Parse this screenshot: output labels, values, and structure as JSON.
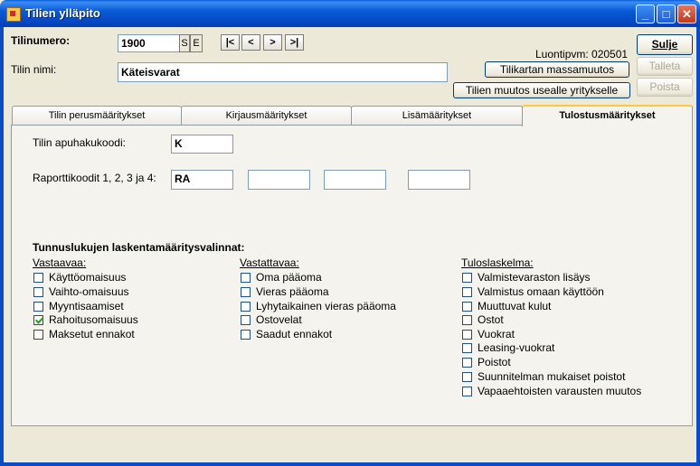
{
  "window": {
    "title": "Tilien ylläpito",
    "controls": {
      "minimize": "_",
      "maximize": "□",
      "close": "✕"
    }
  },
  "header": {
    "account_number_label": "Tilinumero:",
    "account_number_value": "1900",
    "flag_s": "S",
    "flag_e": "E",
    "nav": [
      "|<",
      "<",
      ">",
      ">|"
    ],
    "account_name_label": "Tilin nimi:",
    "account_name_value": "Käteisvarat",
    "created_text": "Luontipvm: 020501",
    "mass_change_button": "Tilikartan massamuutos",
    "multi_company_button": "Tilien muutos usealle yritykselle"
  },
  "actions": {
    "close": "Sulje",
    "save": "Talleta",
    "delete": "Poista"
  },
  "tabs": [
    {
      "label": "Tilin perusmääritykset",
      "active": false
    },
    {
      "label": "Kirjausmääritykset",
      "active": false
    },
    {
      "label": "Lisämääritykset",
      "active": false
    },
    {
      "label": "Tulostusmääritykset",
      "active": true
    }
  ],
  "print_settings": {
    "helper_code_label": "Tilin apuhakukoodi:",
    "helper_code_value": "K",
    "report_codes_label": "Raporttikoodit 1, 2, 3 ja 4:",
    "report_codes": [
      "RA",
      "",
      "",
      ""
    ],
    "kpi_heading": "Tunnuslukujen laskentamääritysvalinnat:",
    "groups": [
      {
        "title": "Vastaavaa:",
        "items": [
          {
            "label": "Käyttöomaisuus",
            "checked": false
          },
          {
            "label": "Vaihto-omaisuus",
            "checked": false
          },
          {
            "label": "Myyntisaamiset",
            "checked": false
          },
          {
            "label": "Rahoitusomaisuus",
            "checked": true
          },
          {
            "label": "Maksetut ennakot",
            "checked": false
          }
        ]
      },
      {
        "title": "Vastattavaa:",
        "items": [
          {
            "label": "Oma pääoma",
            "checked": false
          },
          {
            "label": "Vieras pääoma",
            "checked": false
          },
          {
            "label": "Lyhytaikainen vieras pääoma",
            "checked": false
          },
          {
            "label": "Ostovelat",
            "checked": false
          },
          {
            "label": "Saadut ennakot",
            "checked": false
          }
        ]
      },
      {
        "title": "Tuloslaskelma:",
        "items": [
          {
            "label": "Valmistevaraston lisäys",
            "checked": false
          },
          {
            "label": "Valmistus omaan käyttöön",
            "checked": false
          },
          {
            "label": "Muuttuvat kulut",
            "checked": false
          },
          {
            "label": "Ostot",
            "checked": false
          },
          {
            "label": "Vuokrat",
            "checked": false
          },
          {
            "label": "Leasing-vuokrat",
            "checked": false
          },
          {
            "label": "Poistot",
            "checked": false
          },
          {
            "label": "Suunnitelman mukaiset poistot",
            "checked": false
          },
          {
            "label": "Vapaaehtoisten varausten muutos",
            "checked": false
          }
        ]
      }
    ]
  }
}
